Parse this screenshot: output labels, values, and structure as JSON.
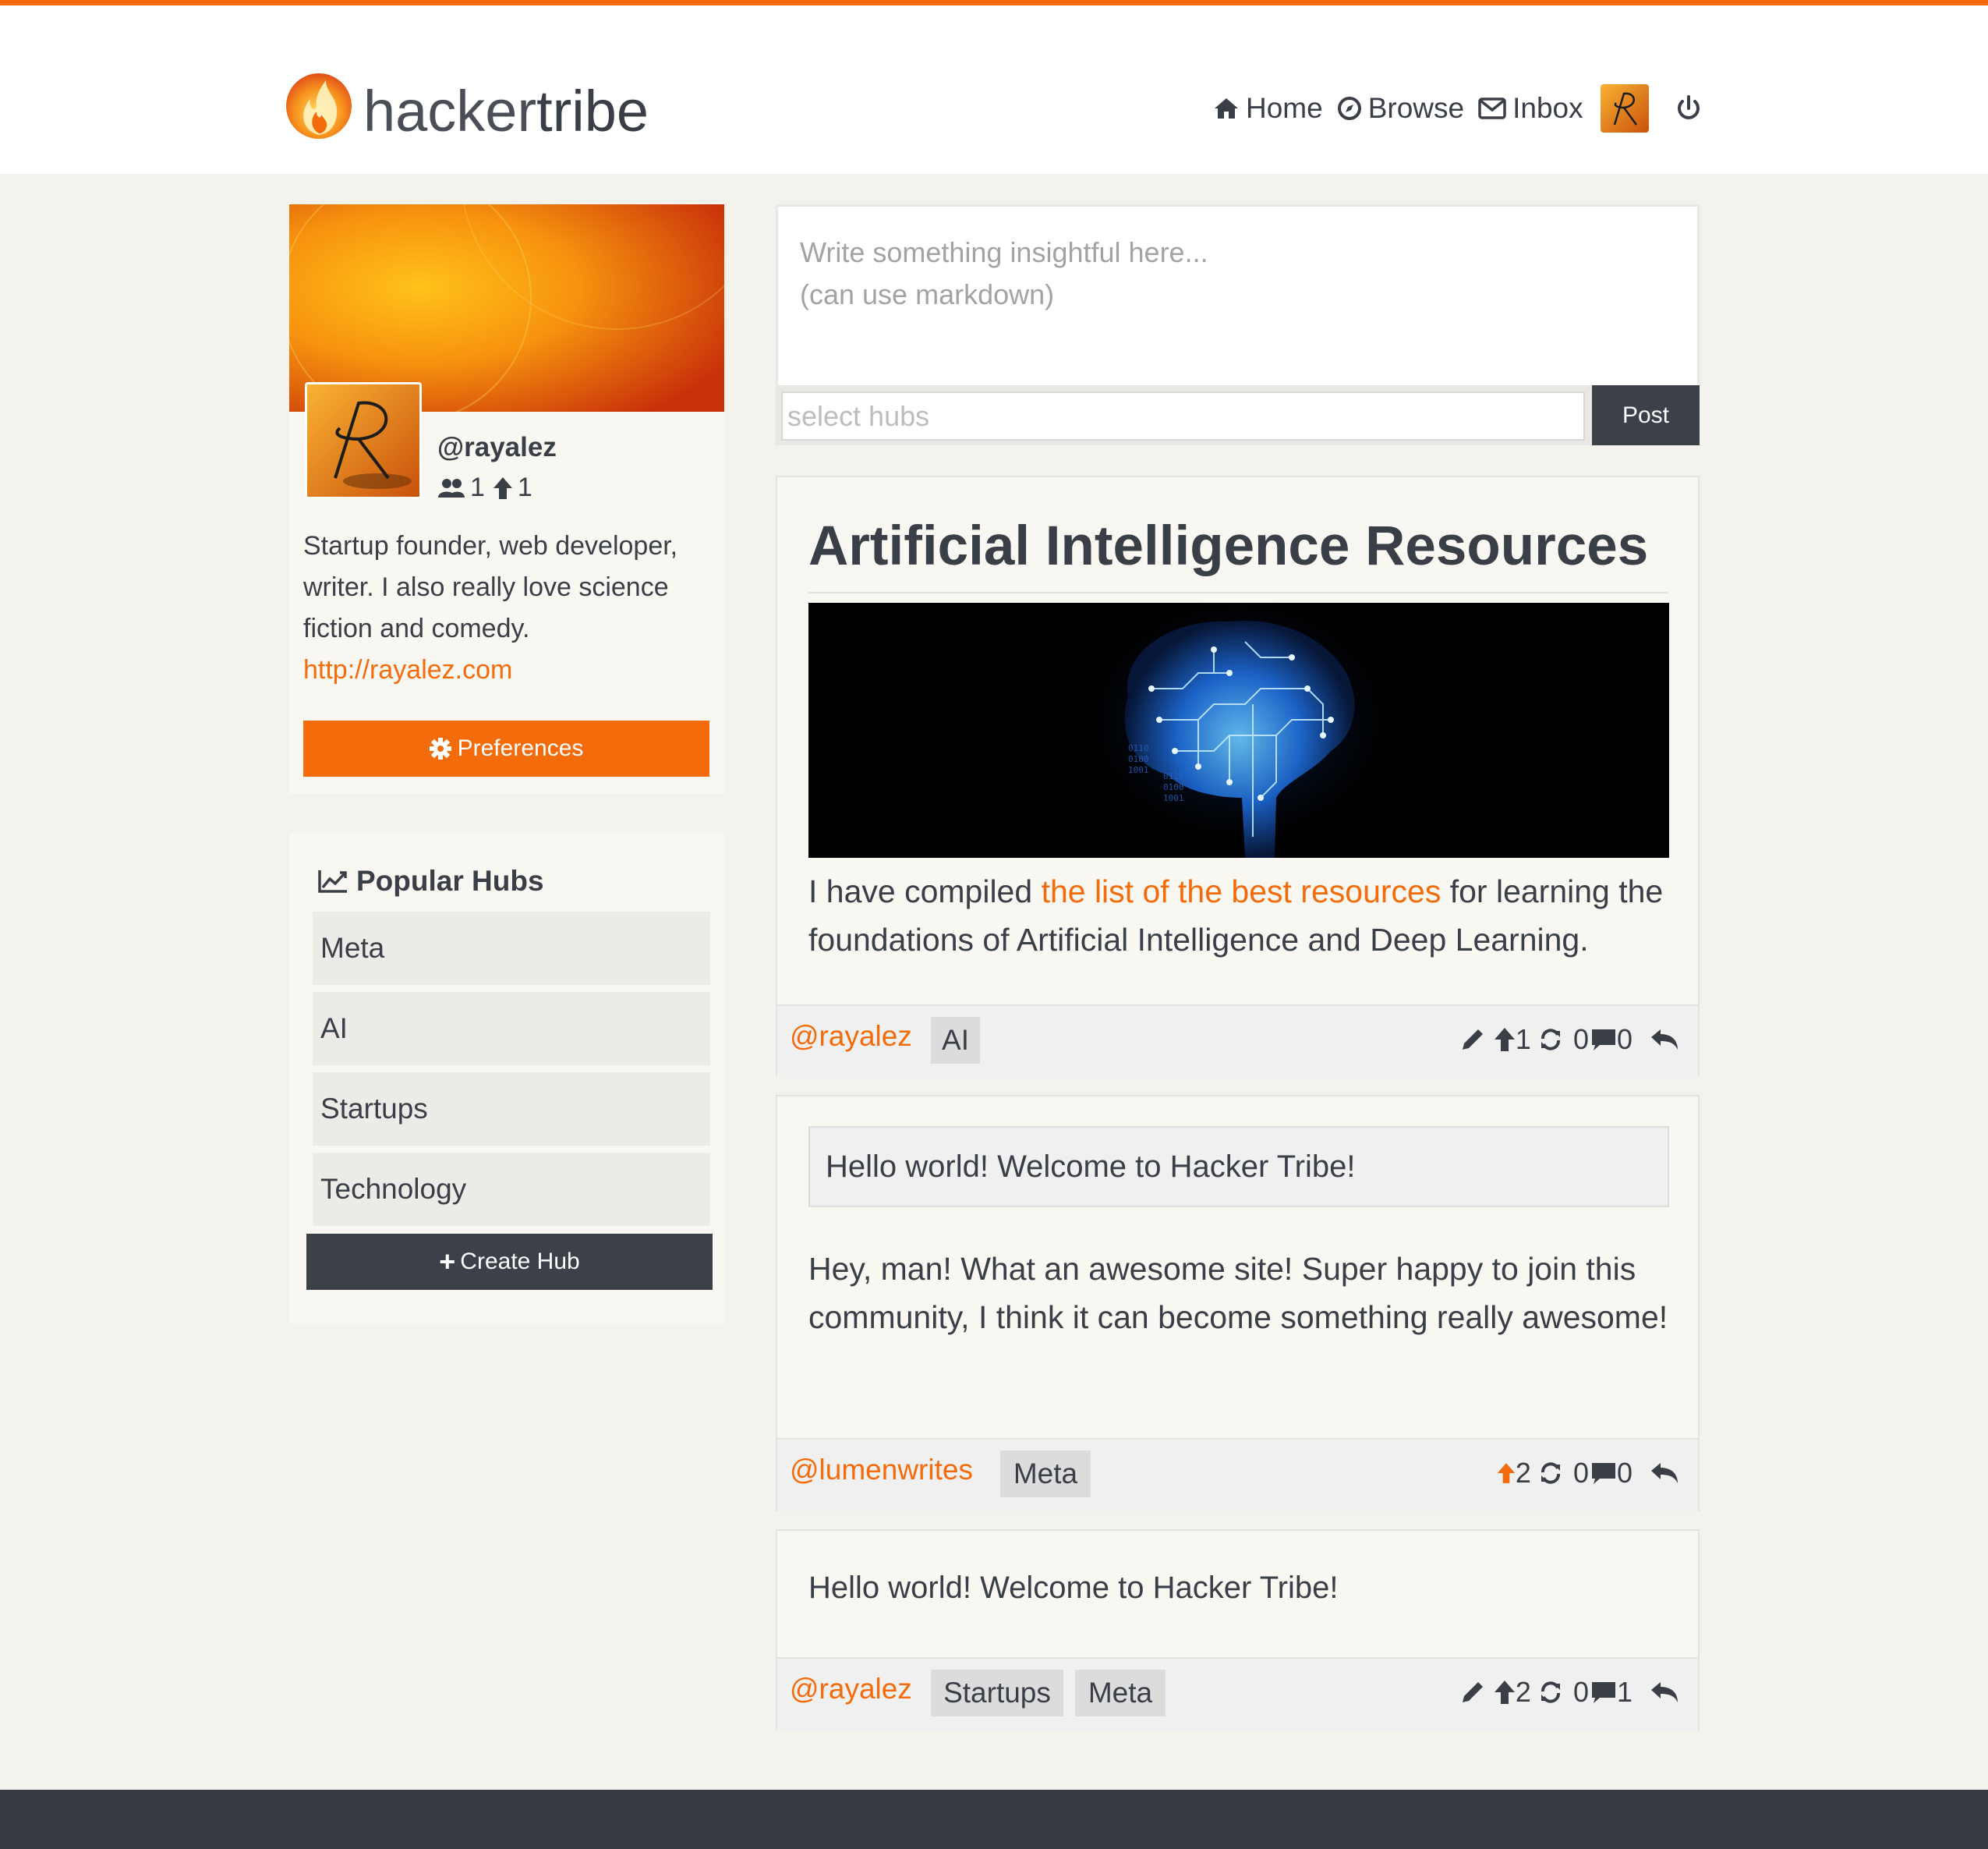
{
  "brand": {
    "light": "hacker",
    "bold": "tribe"
  },
  "nav": {
    "home": "Home",
    "browse": "Browse",
    "inbox": "Inbox"
  },
  "profile": {
    "username": "@rayalez",
    "followers": "1",
    "upvotes": "1",
    "bio": "Startup founder, web developer, writer. I also really love science fiction and comedy.",
    "link": "http://rayalez.com",
    "preferences_label": "Preferences"
  },
  "hubs": {
    "title": "Popular Hubs",
    "items": [
      "Meta",
      "AI",
      "Startups",
      "Technology"
    ],
    "create_label": "Create Hub"
  },
  "composer": {
    "placeholder": "Write something insightful here...\n(can use markdown)",
    "hubs_placeholder": "select hubs",
    "post_label": "Post"
  },
  "posts": [
    {
      "title": "Artificial Intelligence Resources",
      "text_before": "I have compiled ",
      "link_text": "the list of the best resources",
      "text_after": " for learning the foundations of Artificial Intelligence and Deep Learning.",
      "author": "@rayalez",
      "tags": [
        "AI"
      ],
      "upvotes": "1",
      "reposts": "0",
      "comments": "0"
    },
    {
      "quote": "Hello world! Welcome to Hacker Tribe!",
      "text": "Hey, man! What an awesome site! Super happy to join this community, I think it can become something really awesome!",
      "author": "@lumenwrites",
      "tags": [
        "Meta"
      ],
      "upvotes": "2",
      "reposts": "0",
      "comments": "0"
    },
    {
      "text": "Hello world! Welcome to Hacker Tribe!",
      "author": "@rayalez",
      "tags": [
        "Startups",
        "Meta"
      ],
      "upvotes": "2",
      "reposts": "0",
      "comments": "1"
    }
  ],
  "colors": {
    "accent": "#f36b0a",
    "dark": "#3b4049",
    "background": "#f4f2ec"
  }
}
